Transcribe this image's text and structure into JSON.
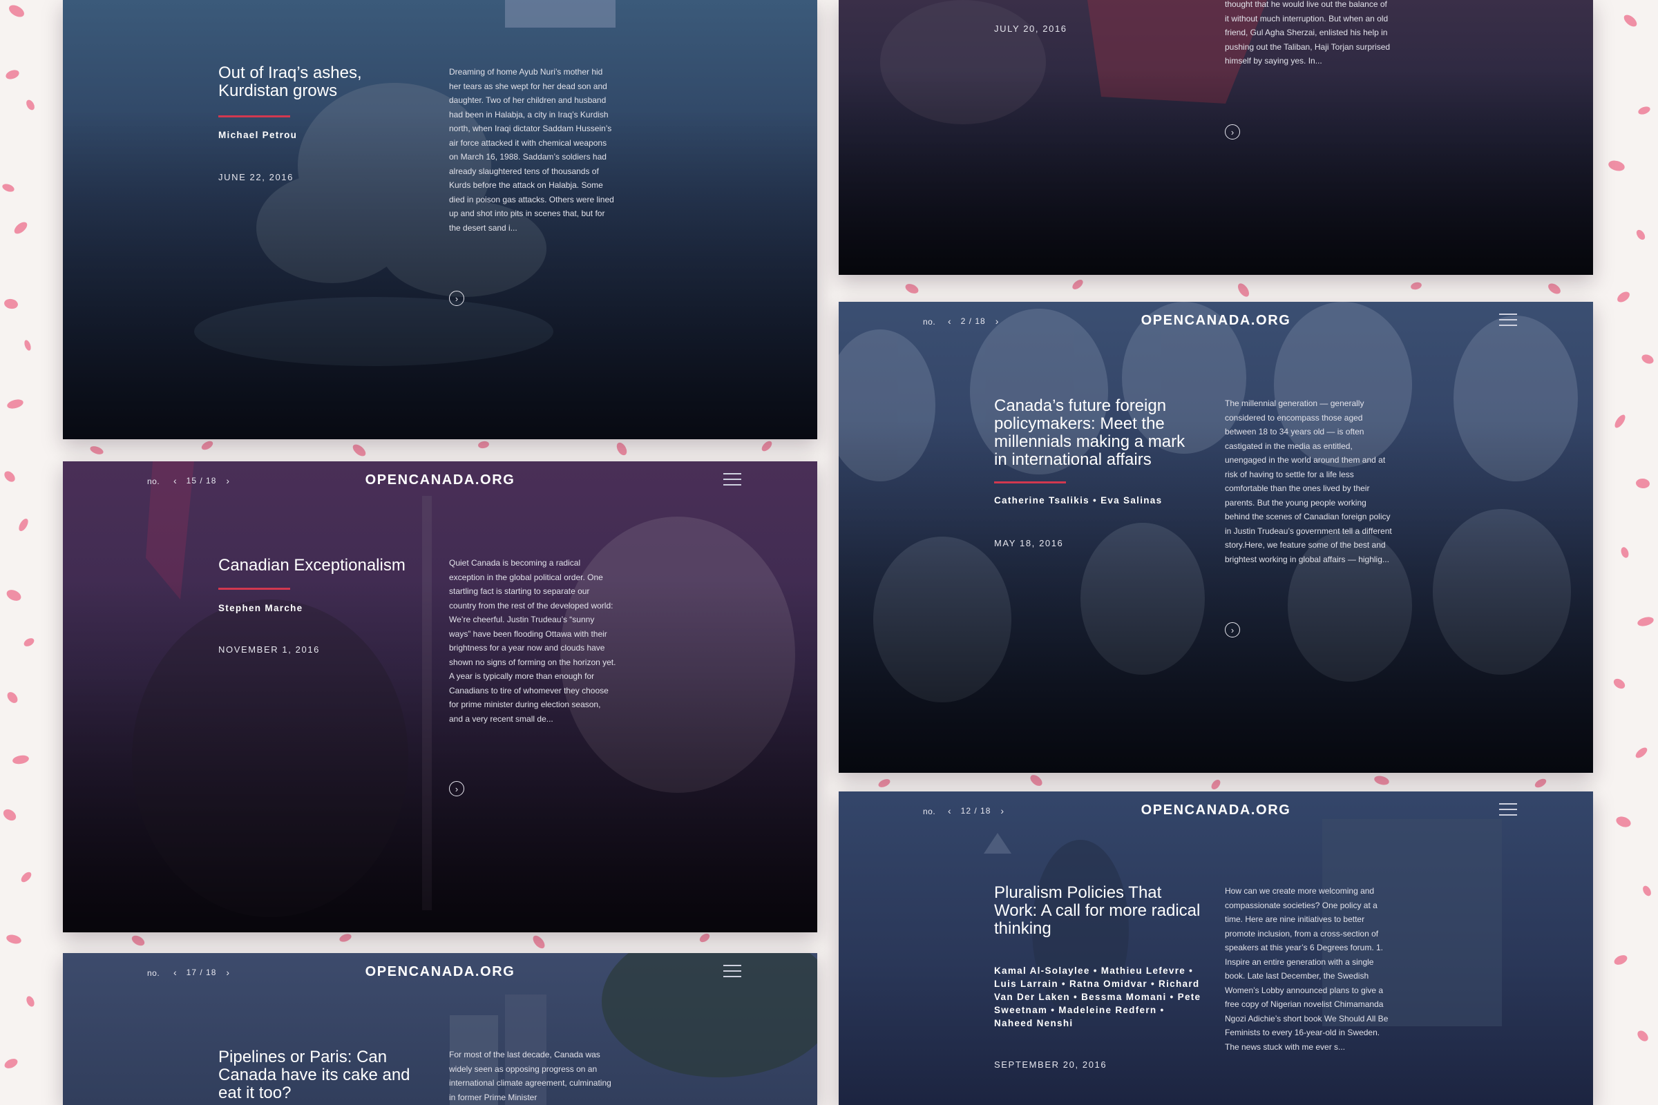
{
  "brand": "OPENCANADA.ORG",
  "no_label": "no.",
  "icons": {
    "prev": "chevron-left-icon",
    "next": "chevron-right-icon",
    "menu": "hamburger-menu-icon",
    "read_more": "circle-arrow-right-icon"
  },
  "colors": {
    "background": "#f7f3f1",
    "confetti": "#ec6e8b",
    "accent_rule": "#d2384f",
    "card_navy": "#2a3557",
    "card_purple": "#3d2447"
  },
  "read_more_glyph": "›",
  "articles": [
    {
      "title": "Out of Iraq’s ashes, Kurdistan grows",
      "authors": "Michael Petrou",
      "date": "JUNE 22, 2016",
      "excerpt": "Dreaming of home Ayub Nuri’s mother hid her tears as she wept for her dead son and daughter. Two of her children and husband had been in Halabja, a city in Iraq’s Kurdish north, when Iraqi dictator Saddam Hussein’s air force attacked it with chemical weapons on March 16, 1988. Saddam’s soldiers had already slaughtered tens of thousands of Kurds before the attack on Halabja. Some died in poison gas attacks. Others were lined up and shot into pits in scenes that, but for the desert sand i..."
    },
    {
      "date": "JULY 20, 2016",
      "excerpt": "thought that he would live out the balance of it without much interruption. But when an old friend, Gul Agha Sherzai, enlisted his help in pushing out the Taliban, Haji Torjan surprised himself by saying yes. In..."
    },
    {
      "pager": "15 / 18",
      "title": "Canadian Exceptionalism",
      "authors": "Stephen Marche",
      "date": "NOVEMBER 1, 2016",
      "excerpt": "Quiet Canada is becoming a radical exception in the global political order. One startling fact is starting to separate our country from the rest of the developed world: We’re cheerful. Justin Trudeau’s “sunny ways” have been flooding Ottawa with their brightness for a year now and clouds have shown no signs of forming on the horizon yet. A year is typically more than enough for Canadians to tire of whomever they choose for prime minister during election season, and a very recent small de..."
    },
    {
      "pager": "2 / 18",
      "title": "Canada’s future foreign policymakers: Meet the millennials making a mark in international affairs",
      "authors": "Catherine Tsalikis • Eva Salinas",
      "date": "MAY 18, 2016",
      "excerpt": "The millennial generation — generally considered to encompass those aged between 18 to 34 years old — is often castigated in the media as entitled, unengaged in the world around them and at risk of having to settle for a life less comfortable than the ones lived by their parents. But the young people working behind the scenes of Canadian foreign policy in Justin Trudeau’s government tell a different story.Here, we feature some of the best and brightest working in global affairs — highlig..."
    },
    {
      "pager": "17 / 18",
      "title": "Pipelines or Paris: Can Canada have its cake and eat it too?",
      "excerpt": "For most of the last decade, Canada was widely seen as opposing progress on an international climate agreement, culminating in former Prime Minister"
    },
    {
      "pager": "12 / 18",
      "title": "Pluralism Policies That Work: A call for more radical thinking",
      "authors": "Kamal Al-Solaylee • Mathieu Lefevre • Luis Larrain • Ratna Omidvar • Richard Van Der Laken • Bessma Momani • Pete Sweetnam • Madeleine Redfern • Naheed Nenshi",
      "date": "SEPTEMBER 20, 2016",
      "excerpt": "How can we create more welcoming and compassionate societies? One policy at a time. Here are nine initiatives to better promote inclusion, from a cross-section of speakers at this year’s 6 Degrees forum. 1. Inspire an entire generation with a single book. Late last December, the Swedish Women’s Lobby announced plans to give a free copy of Nigerian novelist Chimamanda Ngozi Adichie’s short book We Should All Be Feminists to every 16-year-old in Sweden. The news stuck with me ever s..."
    }
  ]
}
